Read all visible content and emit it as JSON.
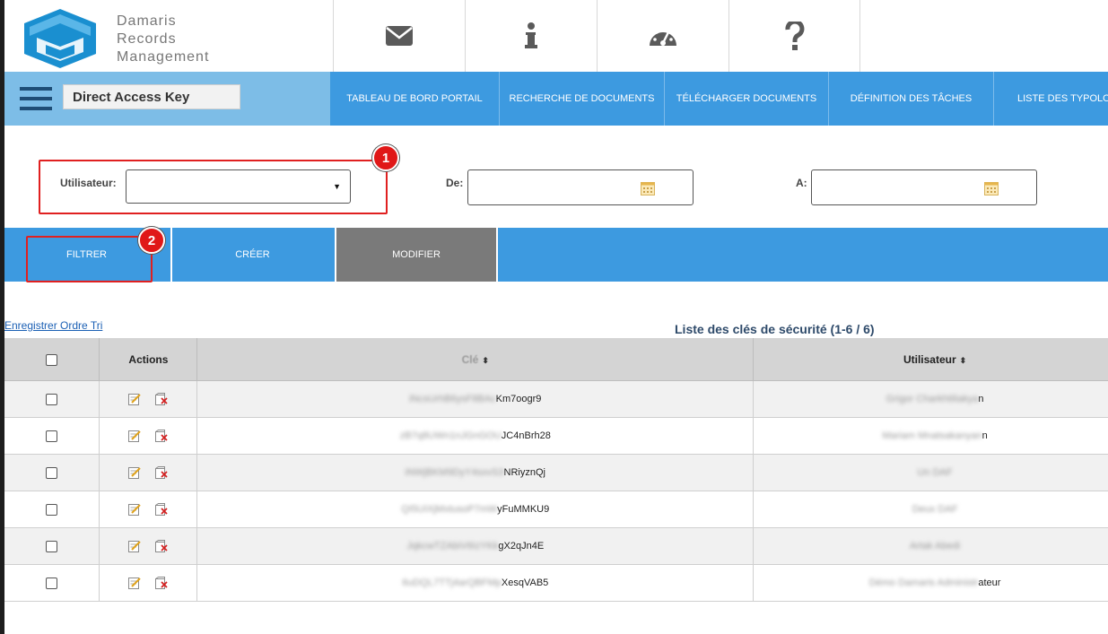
{
  "brand": {
    "line1": "Damaris",
    "line2": "Records",
    "line3": "Management",
    "logo_color": "#1a8fd0"
  },
  "header_icons": [
    "mail-icon",
    "info-icon",
    "dashboard-icon",
    "help-icon"
  ],
  "nav": {
    "current_page": "Direct Access Key",
    "items": [
      "TABLEAU DE BORD PORTAIL",
      "RECHERCHE DE DOCUMENTS",
      "TÉLÉCHARGER DOCUMENTS",
      "DÉFINITION DES TÂCHES",
      "LISTE DES TYPOLO"
    ]
  },
  "filters": {
    "user_label": "Utilisateur:",
    "user_value": "",
    "from_label": "De:",
    "from_value": "",
    "to_label": "A:",
    "to_value": ""
  },
  "annotations": {
    "badge1": "1",
    "badge2": "2"
  },
  "actions": {
    "filter": "FILTRER",
    "create": "CRÉER",
    "modify": "MODIFIER"
  },
  "link_save_order": "Enregistrer Ordre Tri",
  "table": {
    "caption": "Liste des clés de sécurité (1-6 / 6)",
    "headers": {
      "actions": "Actions",
      "key": "Clé",
      "user": "Utilisateur"
    },
    "rows": [
      {
        "key_hidden": "iNcsUrhB6ysF8BAc",
        "key_visible": "Km7oogr9",
        "user_hidden": "Grigor Charkhtiliakya",
        "user_visible": "n"
      },
      {
        "key_hidden": "zB7q8UWn1nJGnGOU",
        "key_visible": "JC4nBrh28",
        "user_hidden": "Mariam Mnatsakanyan",
        "user_visible": "n"
      },
      {
        "key_hidden": "iNWjBKM9DyY4sxvS3",
        "key_visible": "NRiyznQj",
        "user_hidden": "Un DAF",
        "user_visible": ""
      },
      {
        "key_hidden": "QI5UIXjMxtusoP7mW",
        "key_visible": "yFuMMKU9",
        "user_hidden": "Deux DAF",
        "user_visible": ""
      },
      {
        "key_hidden": "JqkcwTZAbiV6IzYKk",
        "key_visible": "gX2qJn4E",
        "user_hidden": "Artak Abedi",
        "user_visible": ""
      },
      {
        "key_hidden": "6uDQL7TTj4arQBFMp",
        "key_visible": "XesqVAB5",
        "user_hidden": "Démo Damaris Administr",
        "user_visible": "ateur"
      }
    ]
  },
  "colors": {
    "nav_blue": "#3d9ae0",
    "nav_light": "#7dbde7",
    "modify_gray": "#7a7a7a",
    "annotation_red": "#e02020"
  }
}
